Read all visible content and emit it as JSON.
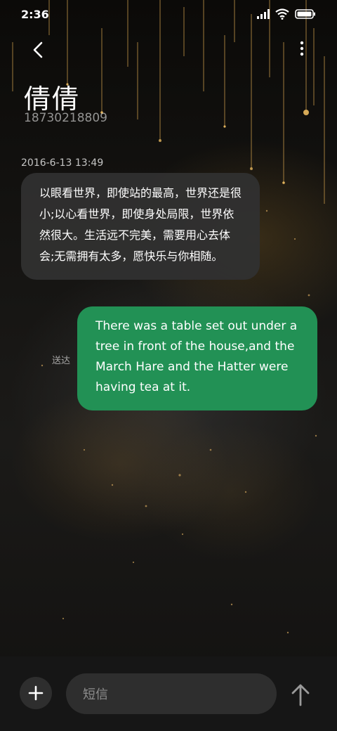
{
  "status_bar": {
    "time": "2:36"
  },
  "contact": {
    "name": "倩倩",
    "number": "18730218809"
  },
  "conversation": {
    "timestamp": "2016-6-13 13:49",
    "incoming_message": "以眼看世界，即使站的最高，世界还是很小;以心看世界，即使身处局限，世界依然很大。生活远不完美，需要用心去体会;无需拥有太多，愿快乐与你相随。",
    "outgoing_message": "There was a table set out under a tree in front of the house,and the March Hare and the Hatter were having tea at it.",
    "outgoing_status": "送达"
  },
  "composer": {
    "placeholder": "短信"
  },
  "icons": [
    "back-icon",
    "more-icon",
    "signal-icon",
    "wifi-icon",
    "battery-icon",
    "add-icon",
    "send-icon"
  ],
  "colors": {
    "outgoing_bubble": "#229155",
    "incoming_bubble": "#303030",
    "composer_bg": "#161616"
  }
}
